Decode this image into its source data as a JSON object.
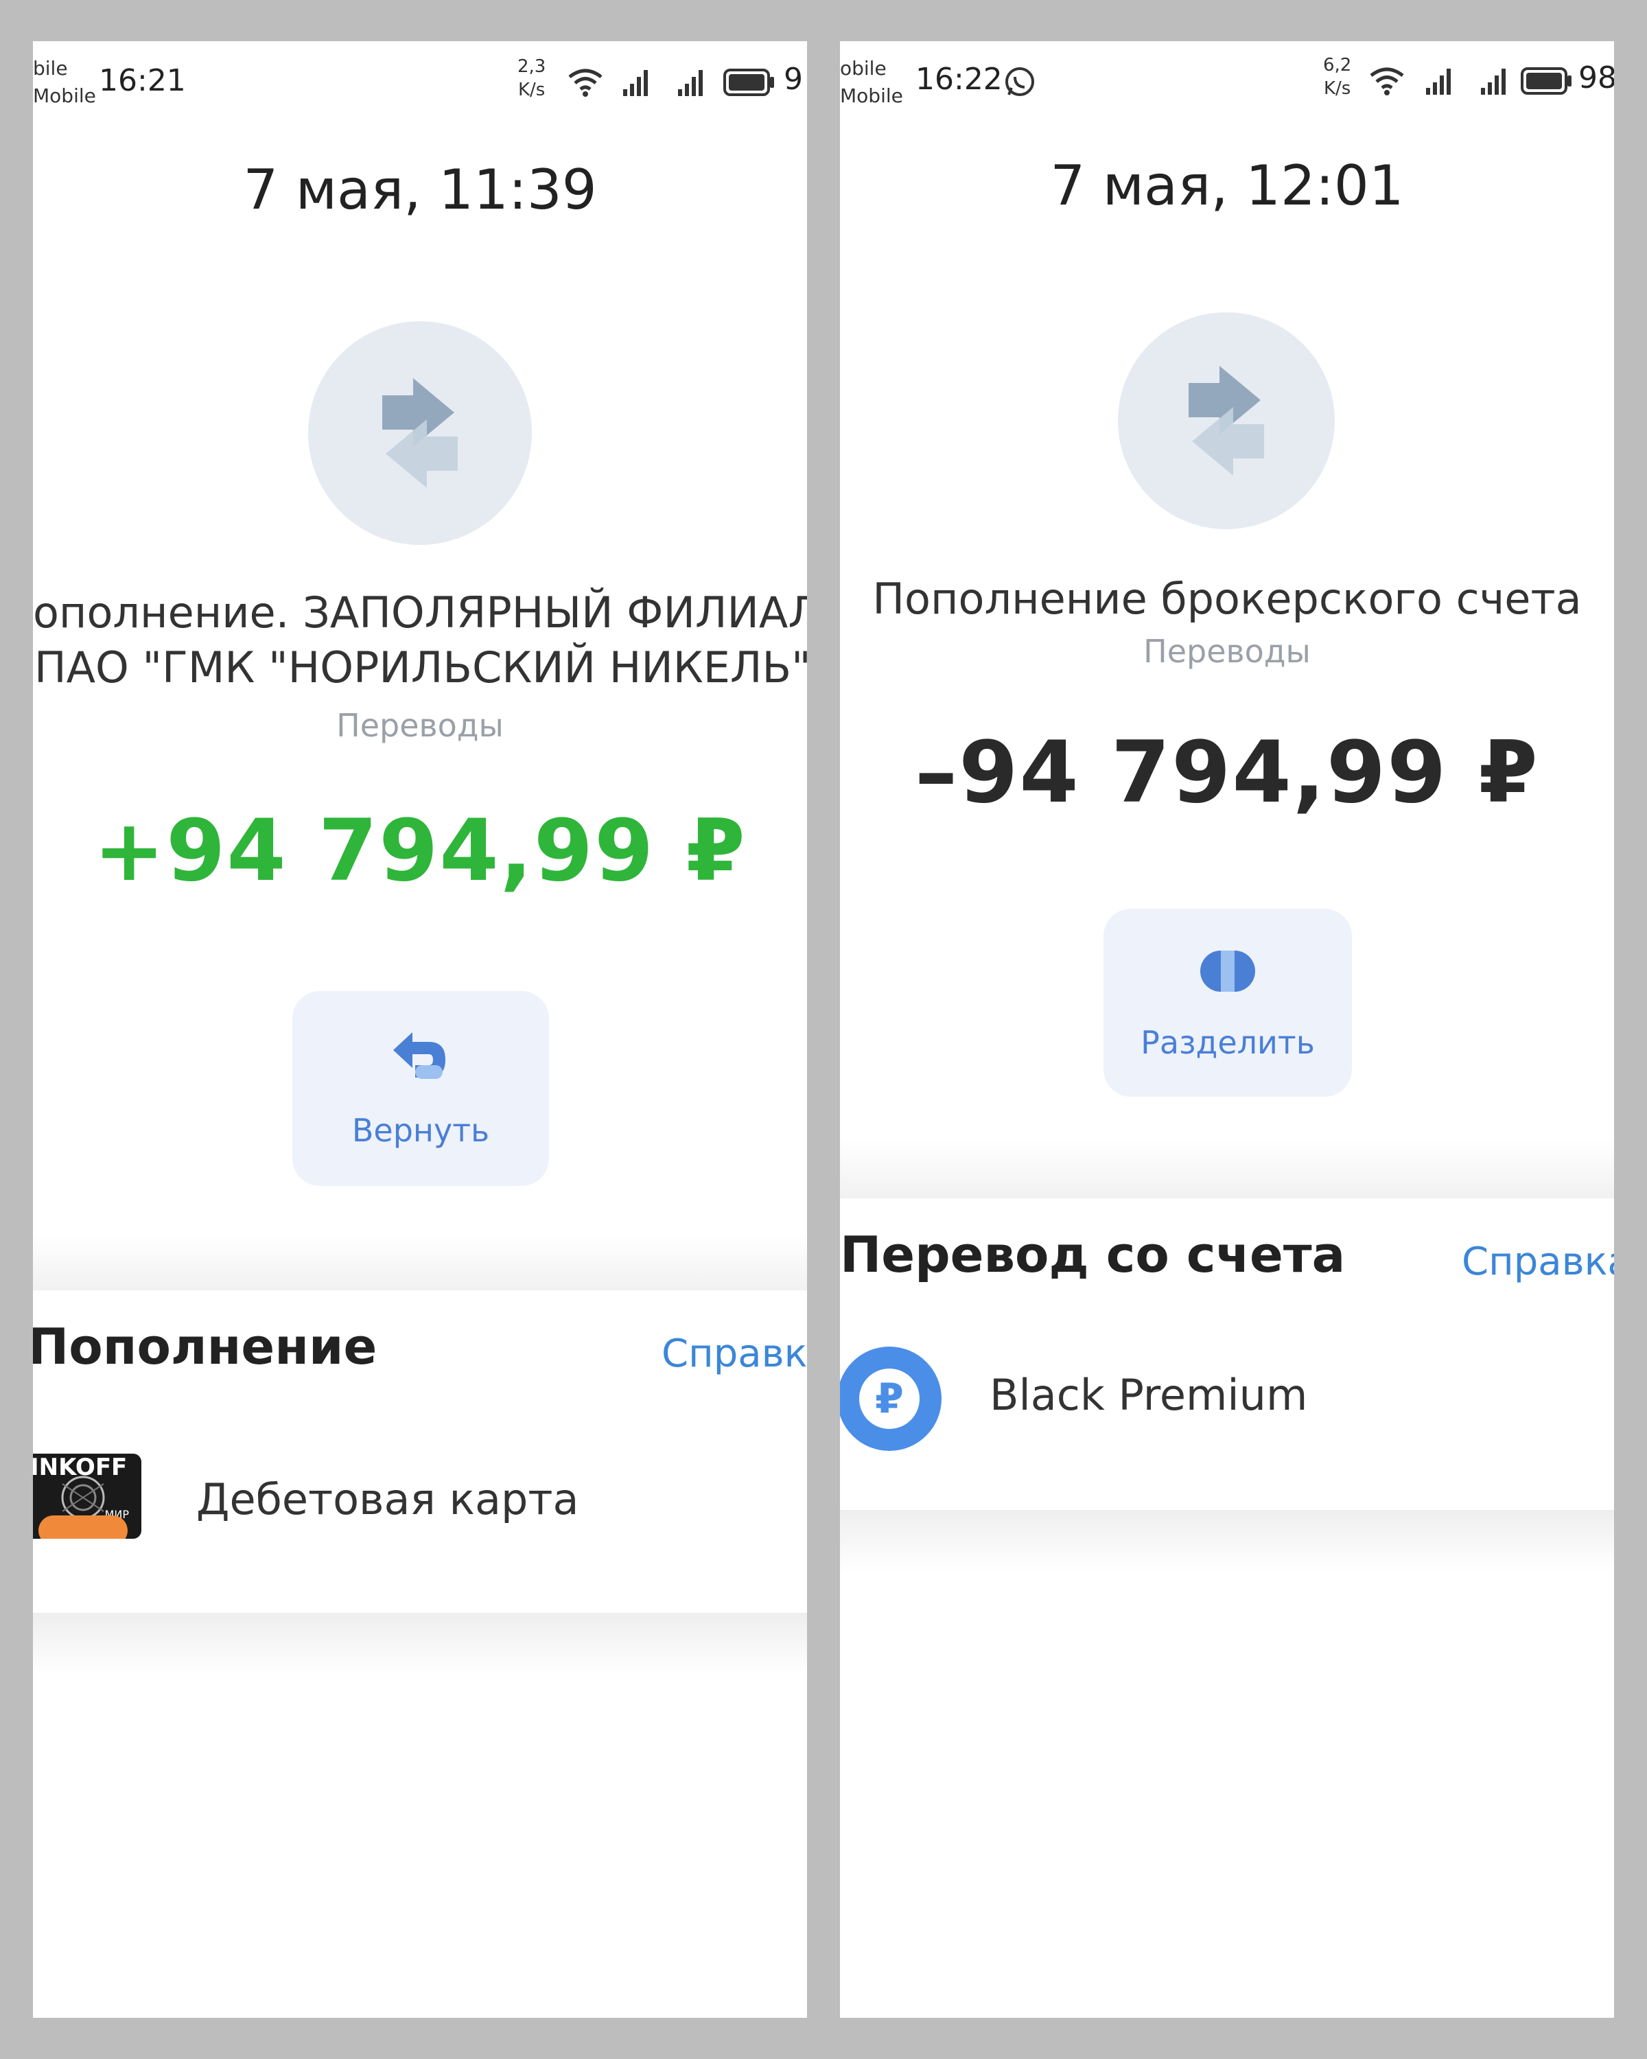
{
  "left": {
    "status": {
      "carrier_line1": "bile",
      "carrier_line2": "Mobile",
      "time": "16:21",
      "speed_value": "2,3",
      "speed_unit": "K/s",
      "battery": "9"
    },
    "date": "7 мая, 11:39",
    "title_line1": "ополнение. ЗАПОЛЯРНЫЙ ФИЛИАЛ",
    "title_line2": "ПАО \"ГМК \"НОРИЛЬСКИЙ НИКЕЛЬ\"",
    "category": "Переводы",
    "amount": "+94 794,99 ₽",
    "action_label": "Вернуть",
    "section_title": "Пополнение",
    "help_label": "Справка",
    "card_text": "INKOFF",
    "card_brand": "МИР",
    "account_label": "Дебетовая карта"
  },
  "right": {
    "status": {
      "carrier_line1": "obile",
      "carrier_line2": "Mobile",
      "time": "16:22",
      "speed_value": "6,2",
      "speed_unit": "K/s",
      "battery": "98"
    },
    "date": "7 мая, 12:01",
    "title": "Пополнение брокерского счета",
    "category": "Переводы",
    "amount": "–94 794,99 ₽",
    "action_label": "Разделить",
    "section_title": "Перевод со счета",
    "help_label": "Справка",
    "account_symbol": "₽",
    "account_label": "Black Premium"
  },
  "colors": {
    "positive": "#2fb53a",
    "link": "#3b86d8",
    "accent": "#4b8ee8",
    "icon_circle": "#e6ebf2"
  },
  "icons": [
    "wifi-icon",
    "signal-icon",
    "battery-icon",
    "whatsapp-icon",
    "transfer-arrows-icon",
    "return-icon",
    "split-icon",
    "ruble-icon"
  ]
}
